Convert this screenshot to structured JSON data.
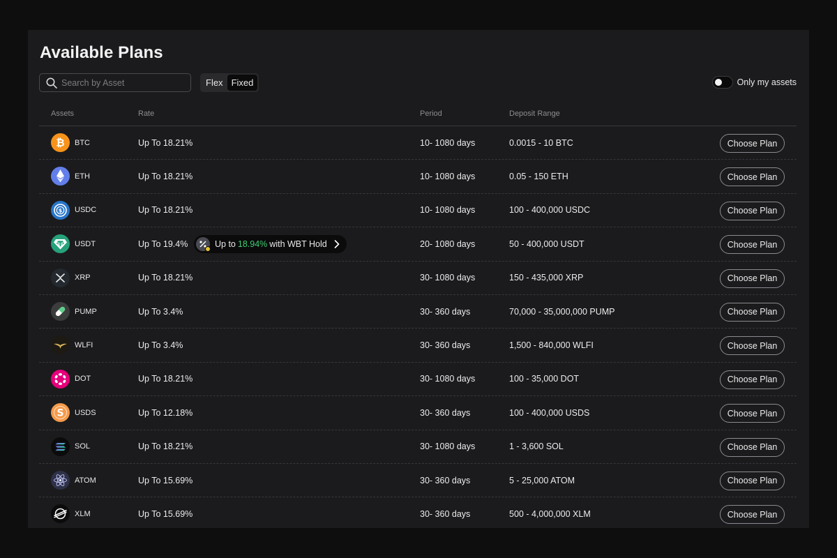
{
  "title": "Available Plans",
  "search": {
    "placeholder": "Search by Asset"
  },
  "segment": {
    "flex": "Flex",
    "fixed": "Fixed",
    "active": "Fixed"
  },
  "toggle": {
    "label": "Only my assets",
    "on": false
  },
  "columns": {
    "assets": "Assets",
    "rate": "Rate",
    "period": "Period",
    "deposit": "Deposit Range"
  },
  "choose_label": "Choose Plan",
  "bonus": {
    "prefix": "Up to",
    "value": "18.94%",
    "suffix": "with WBT Hold"
  },
  "colors": {
    "accent_green": "#3fcf72",
    "background": "#1b1b1d"
  },
  "rows": [
    {
      "symbol": "BTC",
      "rate": "Up To 18.21%",
      "period": "10- 1080 days",
      "deposit": "0.0015 - 10 BTC",
      "icon": "bitcoin-icon",
      "color": "#f7931a"
    },
    {
      "symbol": "ETH",
      "rate": "Up To 18.21%",
      "period": "10- 1080 days",
      "deposit": "0.05 - 150 ETH",
      "icon": "ethereum-icon",
      "color": "#627eea"
    },
    {
      "symbol": "USDC",
      "rate": "Up To 18.21%",
      "period": "10- 1080 days",
      "deposit": "100 - 400,000 USDC",
      "icon": "usdc-icon",
      "color": "#2775ca"
    },
    {
      "symbol": "USDT",
      "rate": "Up To 19.4%",
      "period": "20- 1080 days",
      "deposit": "50 - 400,000 USDT",
      "icon": "tether-icon",
      "color": "#26a17b"
    },
    {
      "symbol": "XRP",
      "rate": "Up To 18.21%",
      "period": "30- 1080 days",
      "deposit": "150 - 435,000 XRP",
      "icon": "xrp-icon",
      "color": "#23292f"
    },
    {
      "symbol": "PUMP",
      "rate": "Up To 3.4%",
      "period": "30- 360 days",
      "deposit": "70,000 - 35,000,000 PUMP",
      "icon": "pill-icon",
      "color": "#3a3d3c"
    },
    {
      "symbol": "WLFI",
      "rate": "Up To 3.4%",
      "period": "30- 360 days",
      "deposit": "1,500 - 840,000 WLFI",
      "icon": "eagle-icon",
      "color": "#1d1a14"
    },
    {
      "symbol": "DOT",
      "rate": "Up To 18.21%",
      "period": "30- 1080 days",
      "deposit": "100 - 35,000 DOT",
      "icon": "polkadot-icon",
      "color": "#e6007a"
    },
    {
      "symbol": "USDS",
      "rate": "Up To 12.18%",
      "period": "30- 360 days",
      "deposit": "100 - 400,000 USDS",
      "icon": "usds-icon",
      "color": "#f59a4b"
    },
    {
      "symbol": "SOL",
      "rate": "Up To 18.21%",
      "period": "30- 1080 days",
      "deposit": "1 - 3,600 SOL",
      "icon": "solana-icon",
      "color": "#0b0b0c"
    },
    {
      "symbol": "ATOM",
      "rate": "Up To 15.69%",
      "period": "30- 360 days",
      "deposit": "5 - 25,000 ATOM",
      "icon": "cosmos-icon",
      "color": "#2e3148"
    },
    {
      "symbol": "XLM",
      "rate": "Up To 15.69%",
      "period": "30- 360 days",
      "deposit": "500 - 4,000,000 XLM",
      "icon": "stellar-icon",
      "color": "#0b0b0c"
    }
  ]
}
